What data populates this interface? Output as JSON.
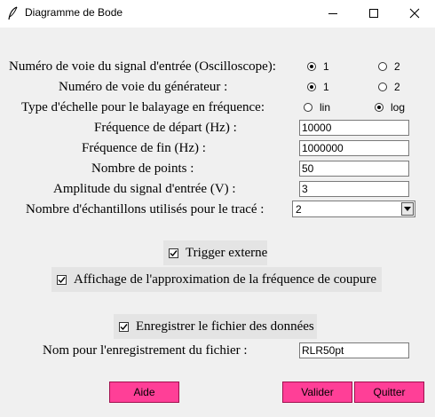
{
  "window": {
    "title": "Diagramme de Bode",
    "app_icon": "feather-icon",
    "controls": [
      "minimize-icon",
      "maximize-icon",
      "close-icon"
    ]
  },
  "form": {
    "channel_input": {
      "label": "Numéro de voie du signal d'entrée (Oscilloscope):",
      "options": [
        "1",
        "2"
      ],
      "selected": "1"
    },
    "channel_generator": {
      "label": "Numéro de voie du générateur :",
      "options": [
        "1",
        "2"
      ],
      "selected": "1"
    },
    "scale_type": {
      "label": "Type d'échelle pour le balayage en fréquence:",
      "options": [
        "lin",
        "log"
      ],
      "selected": "log"
    },
    "start_freq": {
      "label": "Fréquence de départ (Hz) :",
      "value": "10000"
    },
    "end_freq": {
      "label": "Fréquence de fin (Hz) :",
      "value": "1000000"
    },
    "num_points": {
      "label": "Nombre de points :",
      "value": "50"
    },
    "amplitude": {
      "label": "Amplitude du signal d'entrée (V) :",
      "value": "3"
    },
    "samples": {
      "label": "Nombre d'échantillons utilisés pour le tracé :",
      "value": "2"
    },
    "trigger": {
      "label": "Trigger externe",
      "checked": true
    },
    "cutoff_approx": {
      "label": "Affichage de l'approximation de la fréquence de coupure",
      "checked": true
    },
    "save_file": {
      "label": "Enregistrer le fichier des données",
      "checked": true
    },
    "filename": {
      "label": "Nom pour l'enregistrement du fichier :",
      "value": "RLR50pt"
    }
  },
  "buttons": {
    "help": "Aide",
    "validate": "Valider",
    "quit": "Quitter"
  },
  "colors": {
    "button_bg": "#ff3f97",
    "window_bg": "#f0f0f0"
  }
}
